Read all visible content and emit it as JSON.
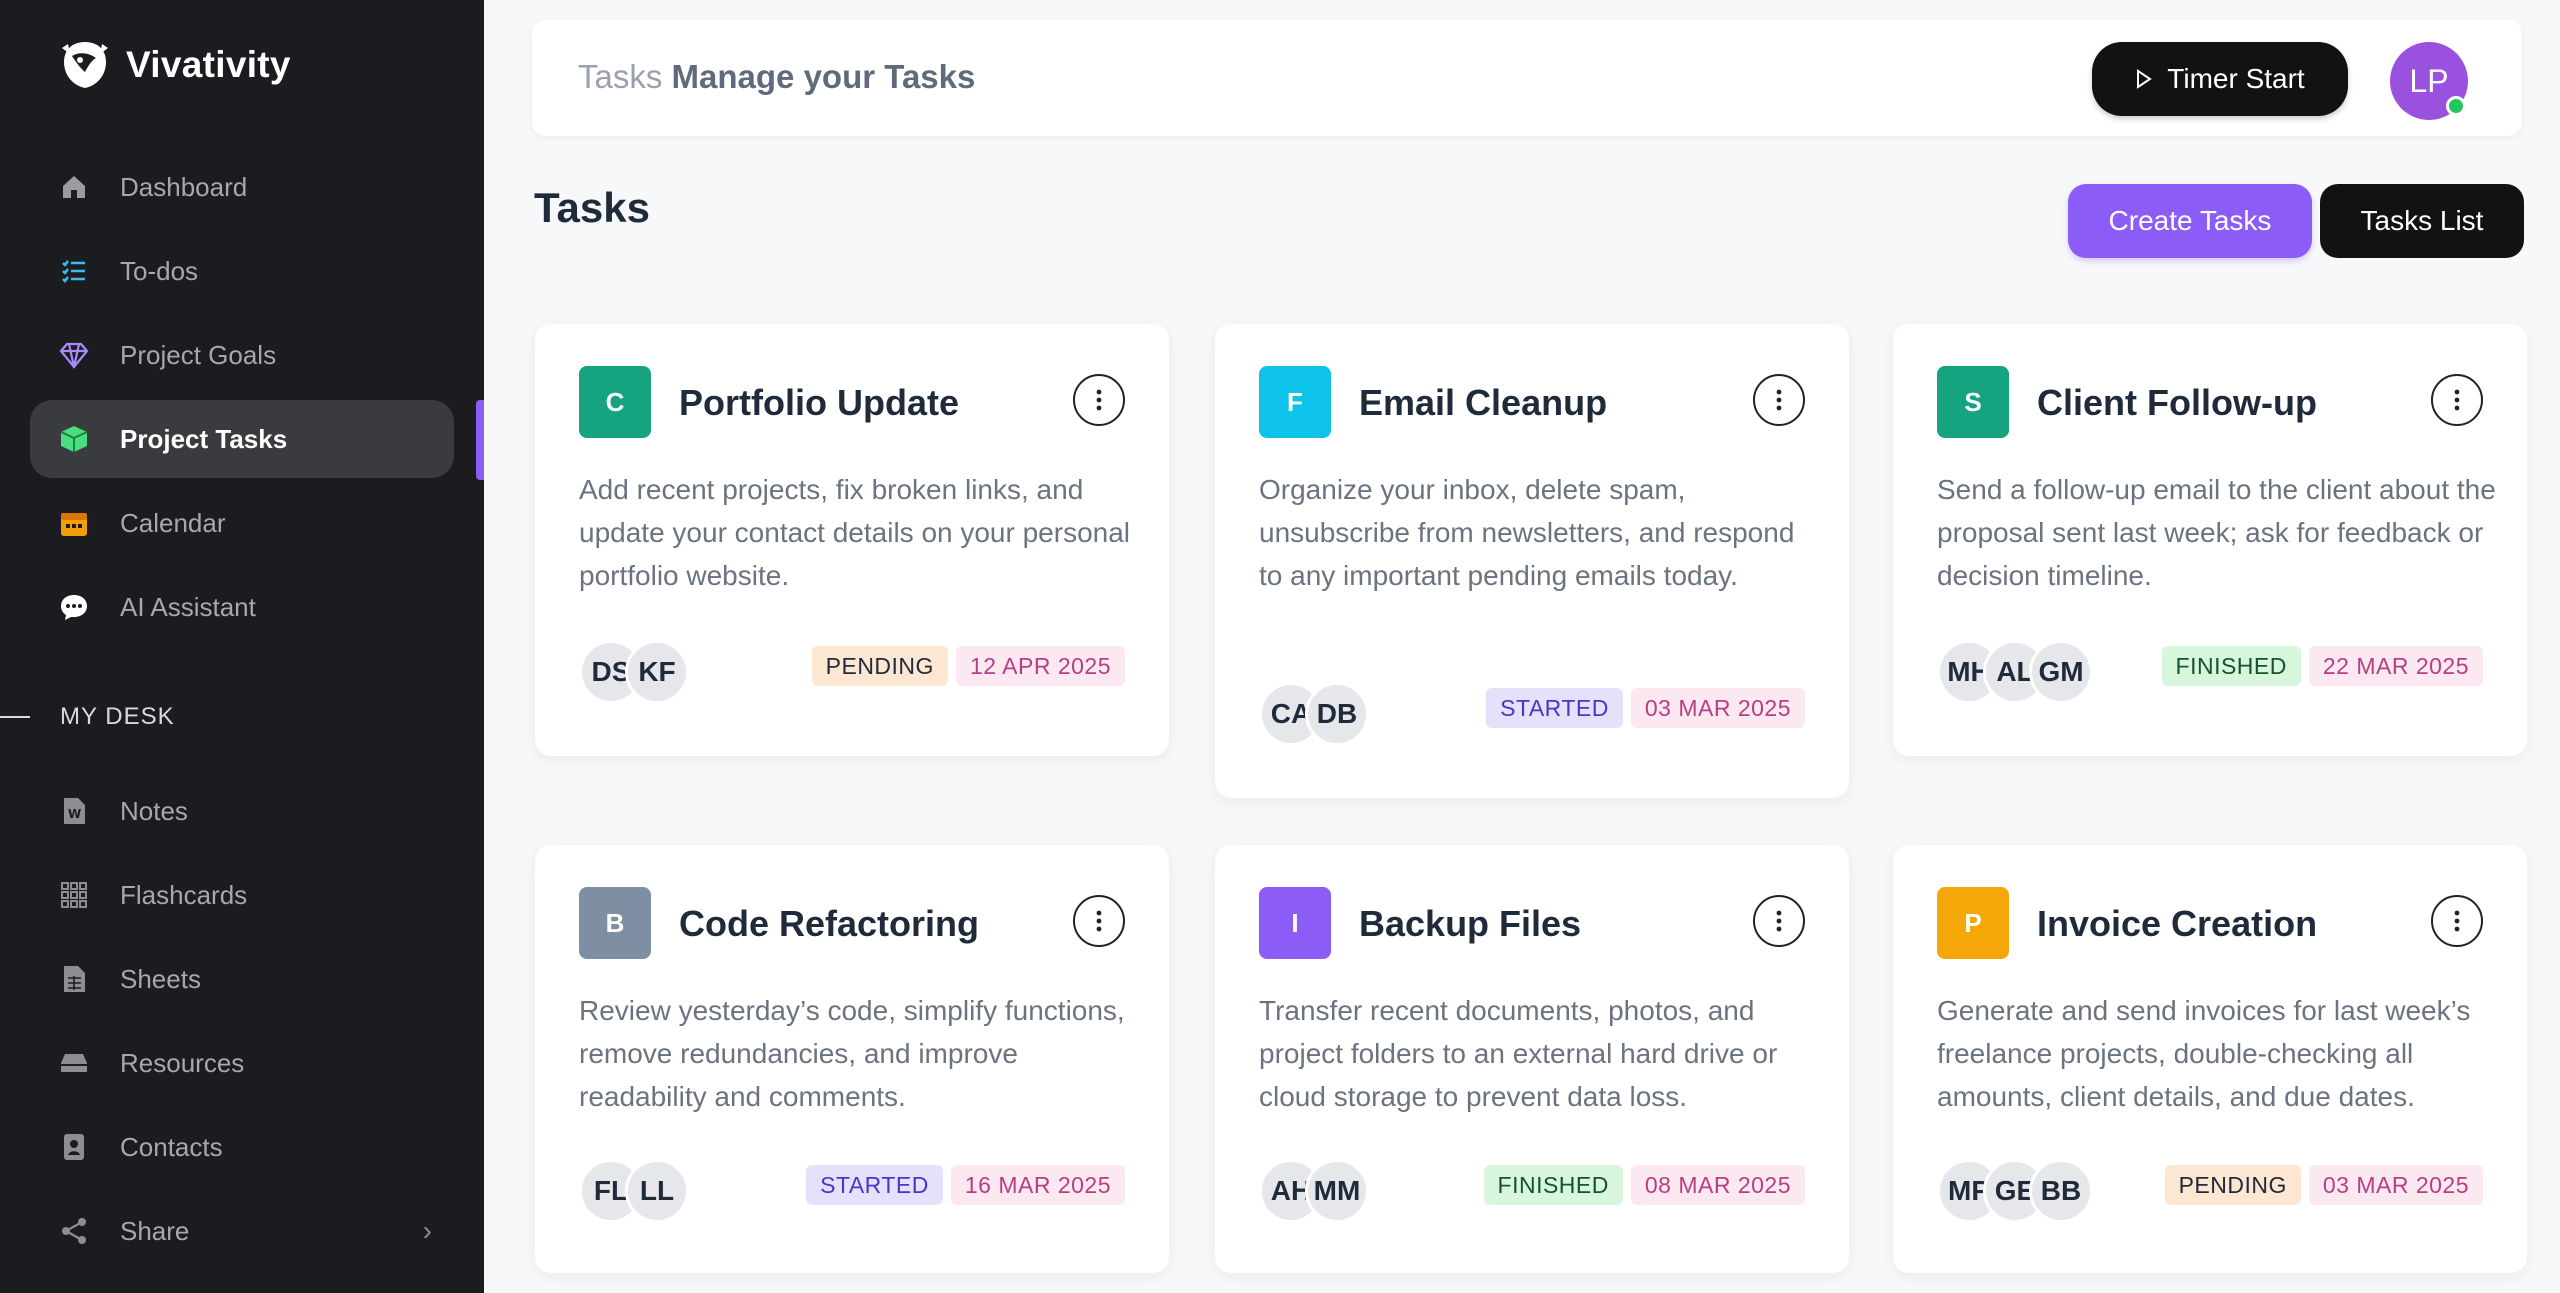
{
  "brand": {
    "name": "Vivativity"
  },
  "sidebar": {
    "items": [
      {
        "label": "Dashboard",
        "icon": "home-icon",
        "color": "#9a9ca1"
      },
      {
        "label": "To-dos",
        "icon": "list-check-icon",
        "color": "#38bdf8"
      },
      {
        "label": "Project Goals",
        "icon": "diamond-icon",
        "color": "#a78bfa"
      },
      {
        "label": "Project Tasks",
        "icon": "cube-icon",
        "color": "#4ade80",
        "active": true
      },
      {
        "label": "Calendar",
        "icon": "calendar-icon",
        "color": "#f59e0b"
      },
      {
        "label": "AI Assistant",
        "icon": "chat-bubble-icon",
        "color": "#ffffff"
      }
    ],
    "section_label": "MY DESK",
    "desk_items": [
      {
        "label": "Notes",
        "icon": "document-icon"
      },
      {
        "label": "Flashcards",
        "icon": "grid-icon"
      },
      {
        "label": "Sheets",
        "icon": "spreadsheet-icon"
      },
      {
        "label": "Resources",
        "icon": "drive-icon"
      },
      {
        "label": "Contacts",
        "icon": "contact-card-icon"
      },
      {
        "label": "Share",
        "icon": "share-icon"
      }
    ]
  },
  "header": {
    "crumb_light": "Tasks",
    "crumb_strong": "Manage your Tasks",
    "timer_label": "Timer Start",
    "avatar_initials": "LP"
  },
  "page": {
    "title": "Tasks",
    "create_label": "Create Tasks",
    "list_label": "Tasks List"
  },
  "tasks": [
    {
      "letter": "C",
      "color": "#16a37f",
      "title": "Portfolio Update",
      "desc": "Add recent projects, fix broken links, and update your contact details on your personal portfolio website.",
      "avatars": [
        "DS",
        "KF"
      ],
      "status": "PENDING",
      "date": "12 APR 2025"
    },
    {
      "letter": "F",
      "color": "#0ec2ea",
      "title": "Email Cleanup",
      "desc": "Organize your inbox, delete spam, unsubscribe from newsletters, and respond to any important pending emails today.",
      "avatars": [
        "CA",
        "DB"
      ],
      "status": "STARTED",
      "date": "03 MAR 2025"
    },
    {
      "letter": "S",
      "color": "#16a37f",
      "title": "Client Follow-up",
      "desc": "Send a follow-up email to the client about the proposal sent last week; ask for feedback or decision timeline.",
      "avatars": [
        "MH",
        "AL",
        "GM"
      ],
      "status": "FINISHED",
      "date": "22 MAR 2025"
    },
    {
      "letter": "B",
      "color": "#7f8fa3",
      "title": "Code Refactoring",
      "desc": "Review yesterday’s code, simplify functions, remove redundancies, and improve readability and comments.",
      "avatars": [
        "FL",
        "LL"
      ],
      "status": "STARTED",
      "date": "16 MAR 2025"
    },
    {
      "letter": "I",
      "color": "#8b5cf6",
      "title": "Backup Files",
      "desc": "Transfer recent documents, photos, and project folders to an external hard drive or cloud storage to prevent data loss.",
      "avatars": [
        "AH",
        "MM"
      ],
      "status": "FINISHED",
      "date": "08 MAR 2025"
    },
    {
      "letter": "P",
      "color": "#f5a70a",
      "title": "Invoice Creation",
      "desc": "Generate and send invoices for last week’s freelance projects, double-checking all amounts, client details, and due dates.",
      "avatars": [
        "MP",
        "GE",
        "BB"
      ],
      "status": "PENDING",
      "date": "03 MAR 2025"
    }
  ]
}
